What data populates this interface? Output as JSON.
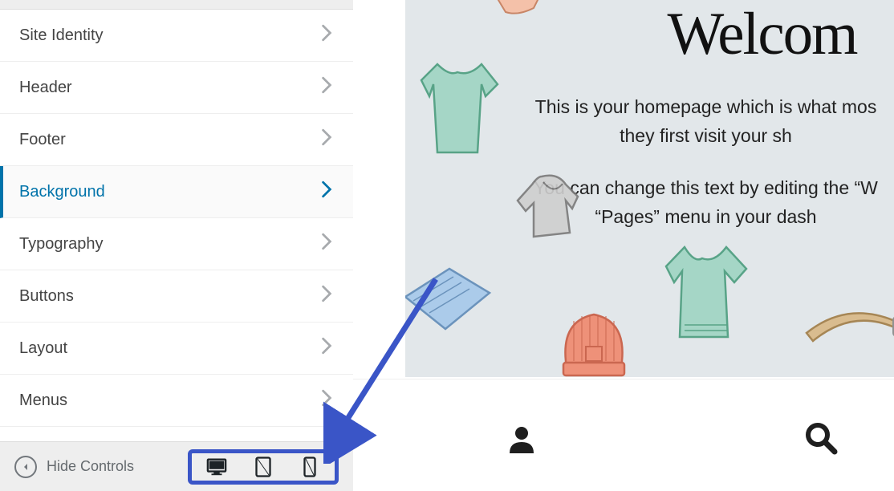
{
  "sidebar": {
    "items": [
      {
        "label": "Site Identity",
        "active": false
      },
      {
        "label": "Header",
        "active": false
      },
      {
        "label": "Footer",
        "active": false
      },
      {
        "label": "Background",
        "active": true
      },
      {
        "label": "Typography",
        "active": false
      },
      {
        "label": "Buttons",
        "active": false
      },
      {
        "label": "Layout",
        "active": false
      },
      {
        "label": "Menus",
        "active": false
      }
    ],
    "hide_controls_label": "Hide Controls",
    "devices": {
      "desktop": "desktop",
      "tablet": "tablet",
      "mobile": "mobile"
    }
  },
  "preview": {
    "title": "Welcom",
    "paragraph1a": "This is your homepage which is what mos",
    "paragraph1b": "they first visit your sh",
    "paragraph2a": "You can change this text by editing the “W",
    "paragraph2b": "“Pages” menu in your dash"
  }
}
